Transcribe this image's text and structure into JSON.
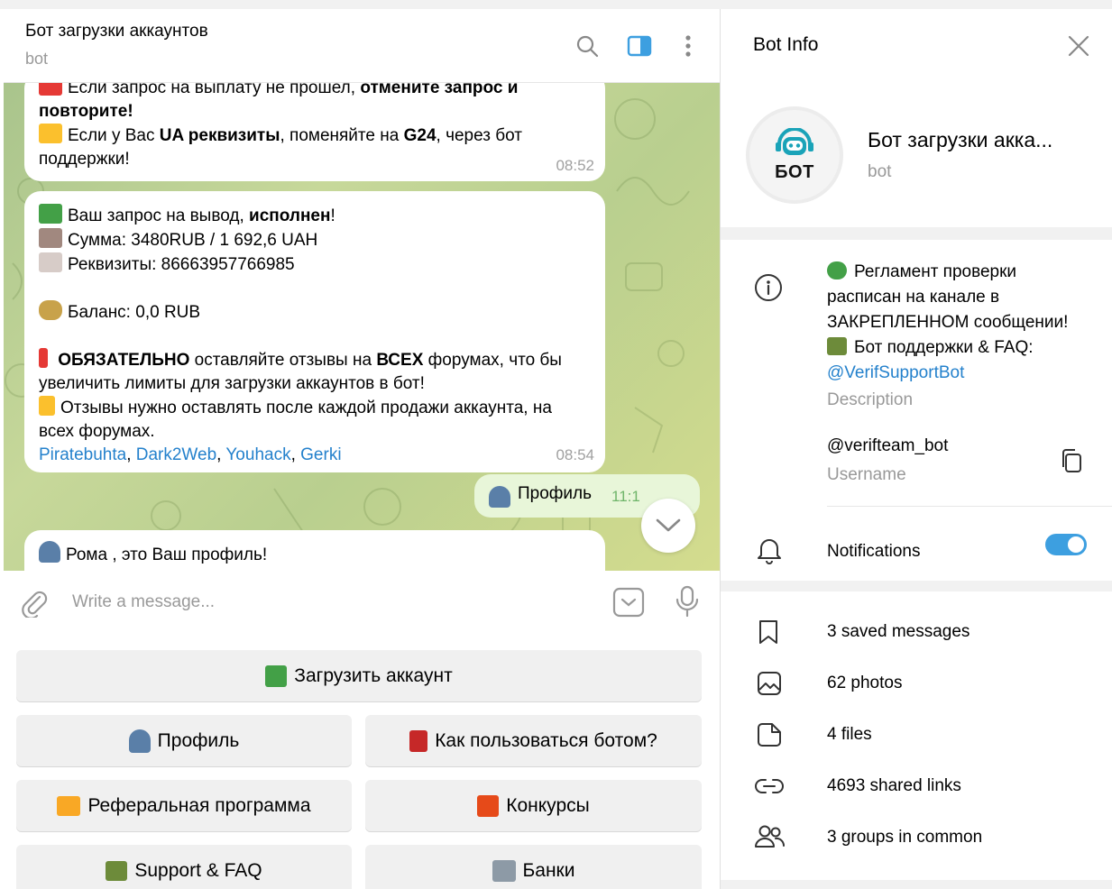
{
  "chat": {
    "title": "Бот загрузки аккаунтов",
    "subtitle": "bot",
    "composer_placeholder": "Write a message..."
  },
  "messages": {
    "m1": {
      "line1_pre": "Если запрос на выплату не прошел, ",
      "line1_bold": "отмените запрос и",
      "line2_bold": "повторите!",
      "line3_pre": "Если у Вас ",
      "line3_bold1": "UA реквизиты",
      "line3_mid": ", поменяйте на ",
      "line3_bold2": "G24",
      "line3_post": ", через бот",
      "line4": "поддержки!",
      "time": "08:52"
    },
    "m2": {
      "l1_pre": "Ваш запрос на вывод, ",
      "l1_bold": "исполнен",
      "l1_post": "!",
      "l2_pre": "Сумма: ",
      "l2_val": "3480RUB  / 1 692,6 UAH",
      "l3_pre": "Реквизиты: ",
      "l3_val": "86663957766985",
      "l4_pre": "Баланс: ",
      "l4_val": "0,0 RUB",
      "l5_bold1": "ОБЯЗАТЕЛЬНО",
      "l5_mid": " оставляйте отзывы на ",
      "l5_bold2": "ВСЕХ",
      "l5_post": " форумах, что бы",
      "l6": "увеличить лимиты для загрузки аккаунтов в бот!",
      "l7": "Отзывы нужно оставлять после каждой продажи аккаунта, на",
      "l8": "всех форумах.",
      "links": [
        "Piratebuhta",
        "Dark2Web",
        "Youhack",
        "Gerki"
      ],
      "sep": ", ",
      "time": "08:54"
    },
    "m3": {
      "text": "Профиль",
      "time": "11:1"
    },
    "m4": {
      "text": "Рома , это Ваш профиль!"
    }
  },
  "keyboard": {
    "upload": "Загрузить аккаунт",
    "profile": "Профиль",
    "howto": "Как пользоваться ботом?",
    "referral": "Реферальная программа",
    "contests": "Конкурсы",
    "support": "Support & FAQ",
    "banks": "Банки"
  },
  "info": {
    "title": "Bot Info",
    "name": "Бот загрузки акка...",
    "subtitle": "bot",
    "avatar_text": "БОТ",
    "desc_l1": "Регламент проверки",
    "desc_l2": "расписан на канале в",
    "desc_l3": "ЗАКРЕПЛЕННОМ сообщении!",
    "desc_l4": "Бот поддержки & FAQ:",
    "desc_link": "@VerifSupportBot",
    "desc_caption": "Description",
    "username": "@verifteam_bot",
    "username_caption": "Username",
    "notifications": "Notifications",
    "notifications_on": true,
    "media": {
      "saved": "3 saved messages",
      "photos": "62 photos",
      "files": "4 files",
      "links": "4693 shared links",
      "groups": "3 groups in common"
    }
  },
  "colors": {
    "accent": "#3d9fe0",
    "link": "#2481cc",
    "outgoing": "#e8f6d9",
    "muted": "#999999"
  }
}
